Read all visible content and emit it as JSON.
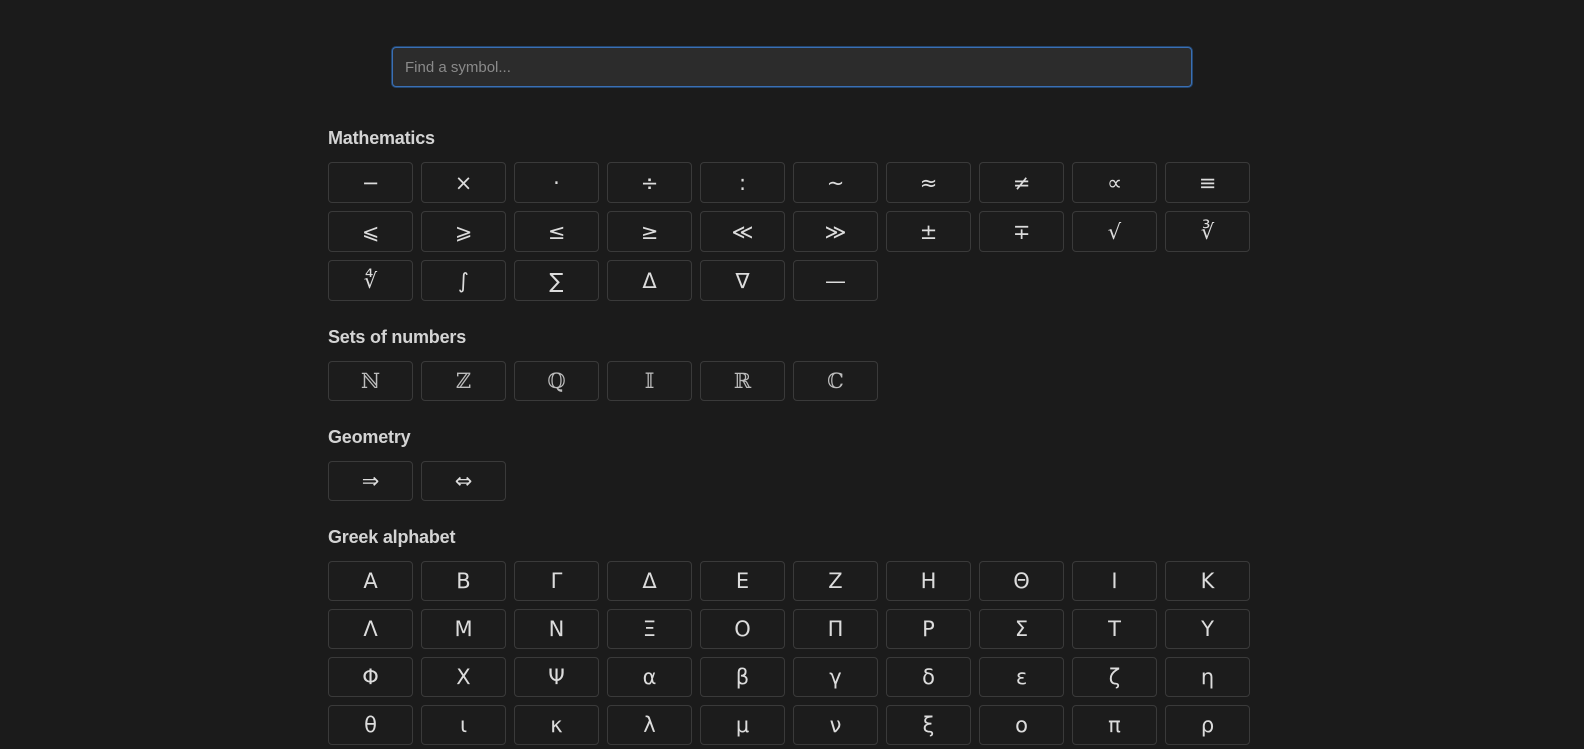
{
  "search": {
    "placeholder": "Find a symbol..."
  },
  "sections": [
    {
      "title": "Mathematics",
      "symbols": [
        "−",
        "×",
        "·",
        "÷",
        ":",
        "~",
        "≈",
        "≠",
        "∝",
        "≡",
        "⩽",
        "⩾",
        "≤",
        "≥",
        "≪",
        "≫",
        "±",
        "∓",
        "√",
        "∛",
        "∜",
        "∫",
        "∑",
        "Δ",
        "∇",
        "—"
      ]
    },
    {
      "title": "Sets of numbers",
      "symbols": [
        "ℕ",
        "ℤ",
        "ℚ",
        "𝕀",
        "ℝ",
        "ℂ"
      ]
    },
    {
      "title": "Geometry",
      "symbols": [
        "⇒",
        "⇔"
      ]
    },
    {
      "title": "Greek alphabet",
      "symbols": [
        "Α",
        "Β",
        "Γ",
        "Δ",
        "Ε",
        "Ζ",
        "Η",
        "Θ",
        "Ι",
        "Κ",
        "Λ",
        "Μ",
        "Ν",
        "Ξ",
        "Ο",
        "Π",
        "Ρ",
        "Σ",
        "Τ",
        "Υ",
        "Φ",
        "Χ",
        "Ψ",
        "α",
        "β",
        "γ",
        "δ",
        "ε",
        "ζ",
        "η",
        "θ",
        "ι",
        "κ",
        "λ",
        "μ",
        "ν",
        "ξ",
        "ο",
        "π",
        "ρ"
      ]
    }
  ]
}
